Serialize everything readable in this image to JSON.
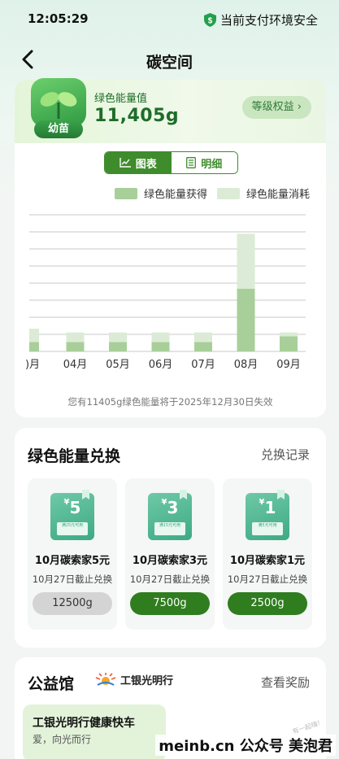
{
  "status": {
    "time": "12:05:29",
    "safety": "当前支付环境安全"
  },
  "nav": {
    "title": "碳空间"
  },
  "energy": {
    "badge": "幼苗",
    "label": "绿色能量值",
    "value": "11,405g",
    "level_btn": "等级权益",
    "tabs": [
      "图表",
      "明细"
    ],
    "legend": [
      "绿色能量获得",
      "绿色能量消耗"
    ],
    "expire_note": "您有11405g绿色能量将于2025年12月30日失效"
  },
  "colors": {
    "gain": "#a8cf9a",
    "use": "#dcebd5",
    "brand": "#3f8c2d"
  },
  "chart_data": {
    "type": "bar",
    "categories": [
      ")月",
      "04月",
      "05月",
      "06月",
      "07月",
      "08月",
      "09月"
    ],
    "series": [
      {
        "name": "绿色能量获得",
        "values": [
          10,
          10,
          10,
          10,
          10,
          66,
          16
        ]
      },
      {
        "name": "绿色能量消耗",
        "values": [
          14,
          10,
          10,
          10,
          10,
          58,
          4
        ]
      }
    ],
    "ylim": [
      0,
      144
    ],
    "grid": true,
    "legend_position": "top-right"
  },
  "exchange": {
    "title": "绿色能量兑换",
    "link": "兑换记录",
    "items": [
      {
        "amount": "5",
        "coupon_sub": "满25元可用",
        "name": "10月碳索家5元",
        "deadline": "10月27日截止兑换",
        "cost": "12500g",
        "available": false
      },
      {
        "amount": "3",
        "coupon_sub": "满15元可用",
        "name": "10月碳索家3元",
        "deadline": "10月27日截止兑换",
        "cost": "7500g",
        "available": true
      },
      {
        "amount": "1",
        "coupon_sub": "满5元可用",
        "name": "10月碳索家1元",
        "deadline": "10月27日截止兑换",
        "cost": "2500g",
        "available": true
      }
    ]
  },
  "charity": {
    "title": "公益馆",
    "partner": "工银光明行",
    "link": "查看奖励",
    "item_title": "工银光明行健康快车",
    "item_sub": "爱，向光而行"
  },
  "watermark": {
    "text": "meinb.cn 公众号 美泡君",
    "stamp": "有一起嗨！"
  }
}
